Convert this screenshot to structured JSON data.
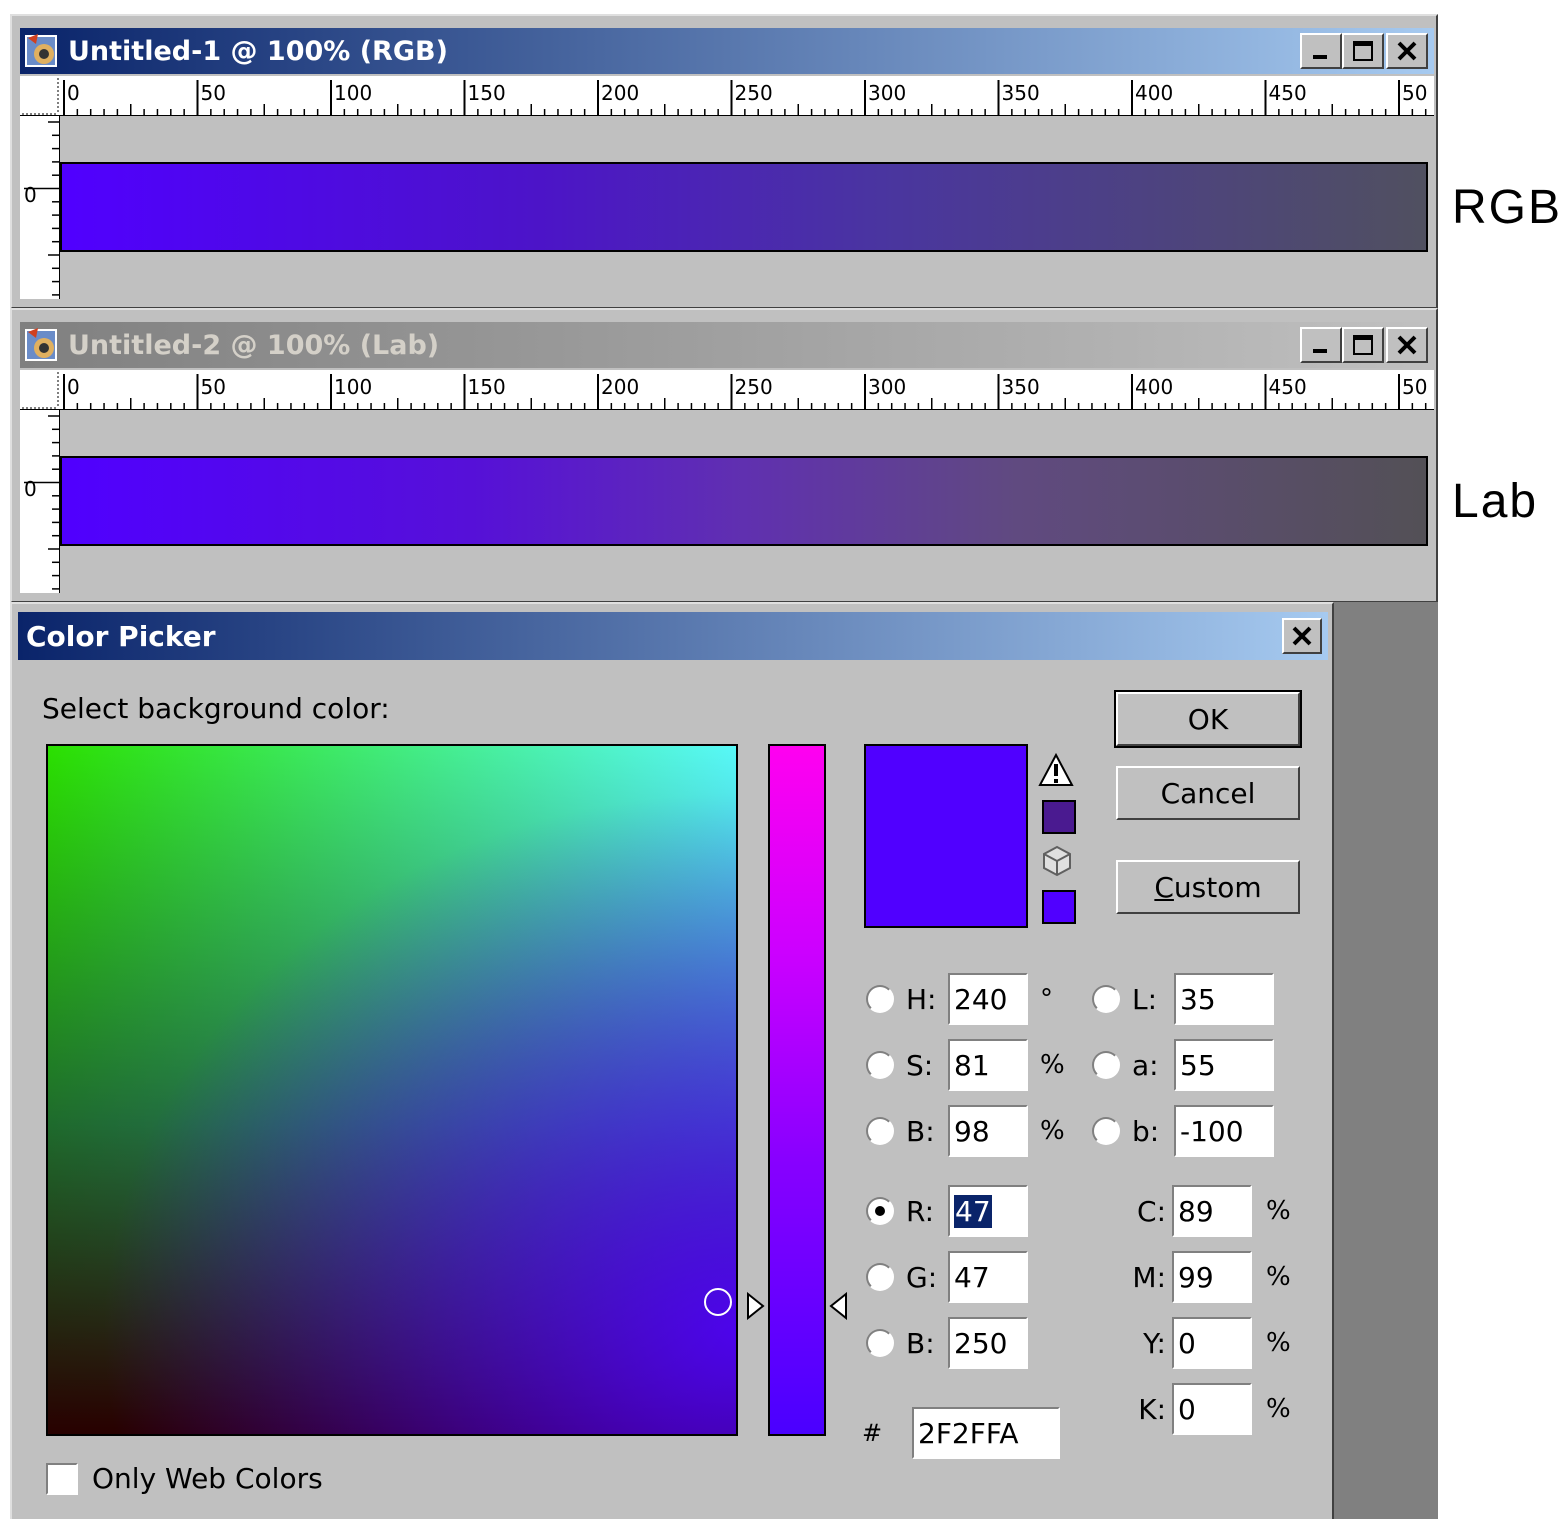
{
  "windows": [
    {
      "title": "Untitled-1 @ 100% (RGB)",
      "side_label": "RGB",
      "ruler_ticks": [
        "0",
        "50",
        "100",
        "150",
        "200",
        "250",
        "300",
        "350",
        "400",
        "450",
        "50"
      ],
      "vruler_label": "0"
    },
    {
      "title": "Untitled-2 @ 100% (Lab)",
      "side_label": "Lab",
      "ruler_ticks": [
        "0",
        "50",
        "100",
        "150",
        "200",
        "250",
        "300",
        "350",
        "400",
        "450",
        "50"
      ],
      "vruler_label": "0"
    }
  ],
  "dialog": {
    "title": "Color Picker",
    "prompt": "Select background color:",
    "buttons": {
      "ok": "OK",
      "cancel": "Cancel",
      "custom": "Custom"
    },
    "hsb": {
      "h_label": "H:",
      "h_value": "240",
      "h_unit": "°",
      "s_label": "S:",
      "s_value": "81",
      "s_unit": "%",
      "b_label": "B:",
      "b_value": "98",
      "b_unit": "%"
    },
    "lab": {
      "l_label": "L:",
      "l_value": "35",
      "a_label": "a:",
      "a_value": "55",
      "b_label": "b:",
      "b_value": "-100"
    },
    "rgb": {
      "r_label": "R:",
      "r_value": "47",
      "g_label": "G:",
      "g_value": "47",
      "b_label": "B:",
      "b_value": "250",
      "selected": "R"
    },
    "cmyk": {
      "c_label": "C:",
      "c_value": "89",
      "c_unit": "%",
      "m_label": "M:",
      "m_value": "99",
      "m_unit": "%",
      "y_label": "Y:",
      "y_value": "0",
      "y_unit": "%",
      "k_label": "K:",
      "k_value": "0",
      "k_unit": "%"
    },
    "hex_label": "#",
    "hex_value": "2F2FFA",
    "only_web_colors": "Only Web Colors",
    "only_web_colors_checked": false
  },
  "colors": {
    "current_color": "#5000ff",
    "gamut_warning_swatch": "#4a1a90",
    "web_safe_swatch": "#5000ff",
    "title_active": "#0a246a",
    "dialog_bg": "#c0c0c0"
  }
}
